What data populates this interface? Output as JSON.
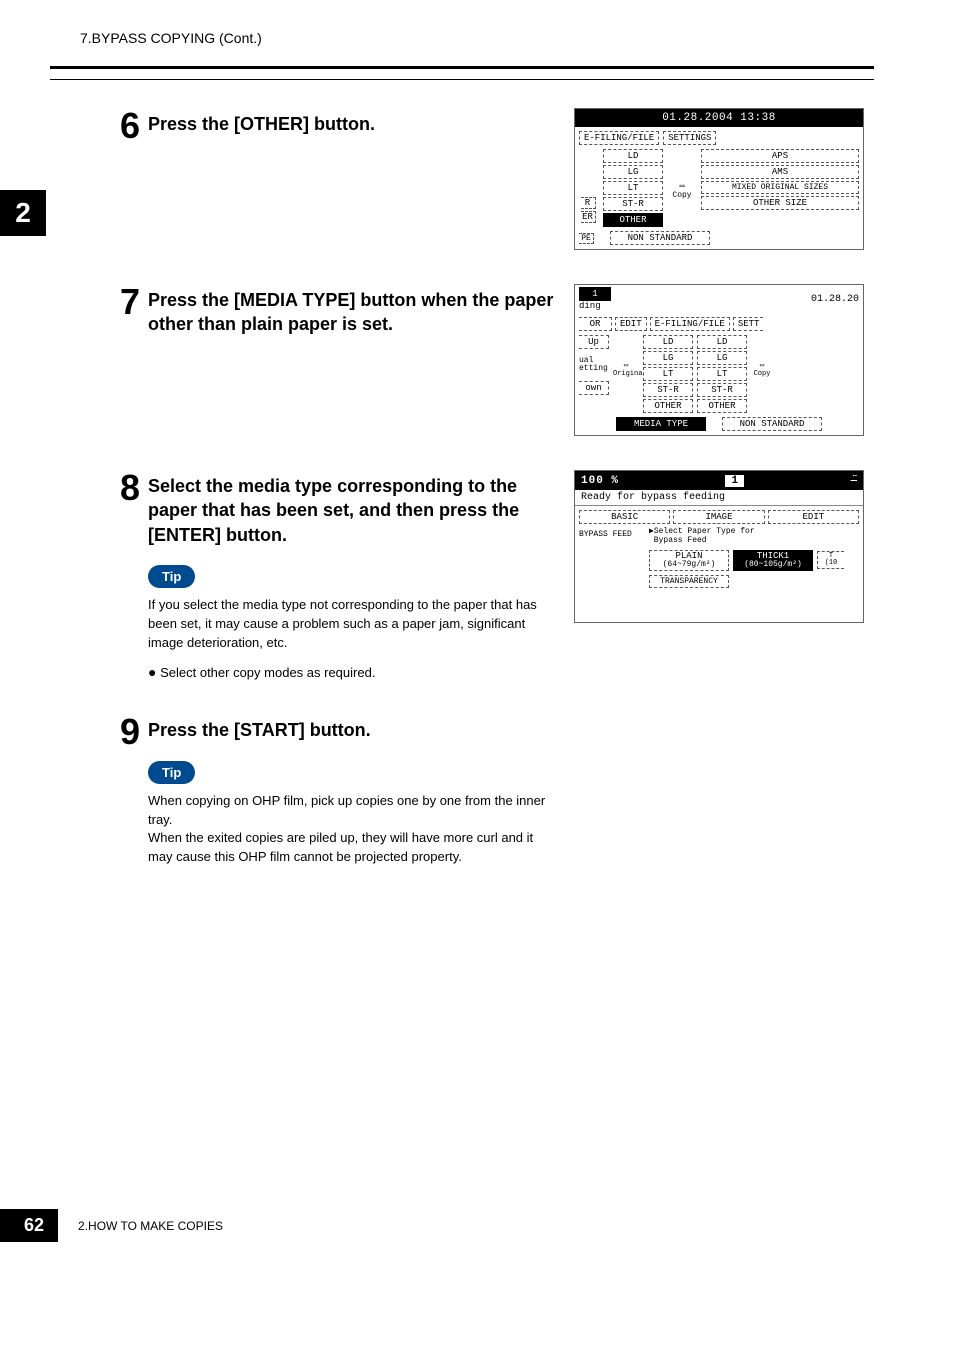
{
  "header": {
    "title": "7.BYPASS COPYING (Cont.)"
  },
  "chapter_tab": "2",
  "steps": {
    "s6": {
      "num": "6",
      "title": "Press the [OTHER] button."
    },
    "s7": {
      "num": "7",
      "title": "Press the [MEDIA TYPE] button when the paper other than plain paper is set."
    },
    "s8": {
      "num": "8",
      "title": " Select the media type corresponding to the paper that has been set, and then press the [ENTER] button.",
      "tip_label": "Tip",
      "tip_text": "If you select the media type not corresponding to the paper that has been set, it may cause a problem such as a paper jam, significant image deterioration, etc.",
      "bullet": "Select other copy modes as required."
    },
    "s9": {
      "num": "9",
      "title": "Press the [START] button.",
      "tip_label": "Tip",
      "tip_text": "When copying on OHP film, pick up copies one by one from the inner tray.\nWhen the exited copies are piled up, they will have more curl and it may cause this OHP film cannot be projected property."
    }
  },
  "panel6": {
    "datetime": "01.28.2004 13:38",
    "tabs": {
      "efiling": "E-FILING/FILE",
      "settings": "SETTINGS"
    },
    "left_col": [
      "LD",
      "LG",
      "LT",
      "ST-R",
      "OTHER"
    ],
    "right_col": [
      "APS",
      "AMS",
      "MIXED ORIGINAL SIZES",
      "OTHER SIZE"
    ],
    "copy_label": "Copy",
    "side_labels": [
      "R",
      "ER",
      "PE"
    ],
    "bottom": "NON STANDARD"
  },
  "panel7": {
    "date_cut": "01.28.20",
    "top_left": "1",
    "ding": "ding",
    "tabs": {
      "or": "OR",
      "edit": "EDIT",
      "efiling": "E-FILING/FILE",
      "sett": "SETT"
    },
    "side": [
      "Up",
      "ual\netting",
      "own"
    ],
    "orig_label": "Original",
    "copy_label": "Copy",
    "col1": [
      "LD",
      "LG",
      "LT",
      "ST-R",
      "OTHER"
    ],
    "col2": [
      "LD",
      "LG",
      "LT",
      "ST-R",
      "OTHER"
    ],
    "bottom_left": "MEDIA TYPE",
    "bottom_right": "NON STANDARD"
  },
  "panel8": {
    "zoom": "100 %",
    "count": "1",
    "ready": "Ready for bypass feeding",
    "tabs": {
      "basic": "BASIC",
      "image": "IMAGE",
      "edit": "EDIT"
    },
    "bypass_label": "BYPASS FEED",
    "instruction": "▶Select Paper Type for\n Bypass Feed",
    "plain": "PLAIN",
    "plain_sub": "(64~79g/m²)",
    "thick1": "THICK1",
    "thick1_sub": "(80~105g/m²)",
    "extra": "T\n(10",
    "transparency": "TRANSPARENCY"
  },
  "footer": {
    "page": "62",
    "chapter": "2.HOW TO MAKE COPIES"
  }
}
